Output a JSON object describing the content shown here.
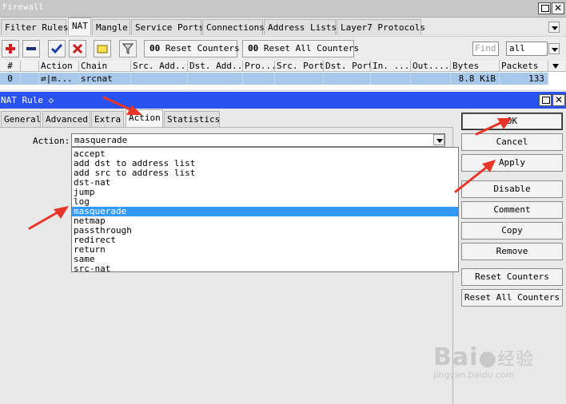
{
  "firewall": {
    "title": "Firewall",
    "tabs": [
      "Filter Rules",
      "NAT",
      "Mangle",
      "Service Ports",
      "Connections",
      "Address Lists",
      "Layer7 Protocols"
    ],
    "toolbar": {
      "reset_counters": "Reset Counters",
      "reset_all_counters": "Reset All Counters",
      "counter_prefix": "00",
      "find_placeholder": "Find",
      "filter_value": "all"
    },
    "table": {
      "columns": [
        "#",
        "",
        "Action",
        "Chain",
        "Src. Add...",
        "Dst. Add...",
        "Pro...",
        "Src. Port",
        "Dst. Port",
        "In. ...",
        "Out....",
        "Bytes",
        "Packets"
      ],
      "row": {
        "number": "0",
        "action": "⇄|m...",
        "chain": "srcnat",
        "bytes": "8.8 KiB",
        "packets": "133"
      }
    }
  },
  "nat_rule": {
    "title": "NAT Rule ◇",
    "tabs": [
      "General",
      "Advanced",
      "Extra",
      "Action",
      "Statistics"
    ],
    "action_label": "Action:",
    "action_value": "masquerade",
    "action_options": [
      "accept",
      "add dst to address list",
      "add src to address list",
      "dst-nat",
      "jump",
      "log",
      "masquerade",
      "netmap",
      "passthrough",
      "redirect",
      "return",
      "same",
      "src-nat"
    ],
    "buttons": {
      "ok": "OK",
      "cancel": "Cancel",
      "apply": "Apply",
      "disable": "Disable",
      "comment": "Comment",
      "copy": "Copy",
      "remove": "Remove",
      "reset_counters": "Reset Counters",
      "reset_all_counters": "Reset All Counters"
    }
  },
  "watermark": {
    "brand": "Bai",
    "brand_suffix": "经验",
    "url": "jingyan.baidu.com"
  },
  "colors": {
    "dialog_title": "#2a52f0",
    "selected_row": "#a8c8ea",
    "selected_option": "#3399ff",
    "annotation_arrow": "#e8352a"
  }
}
